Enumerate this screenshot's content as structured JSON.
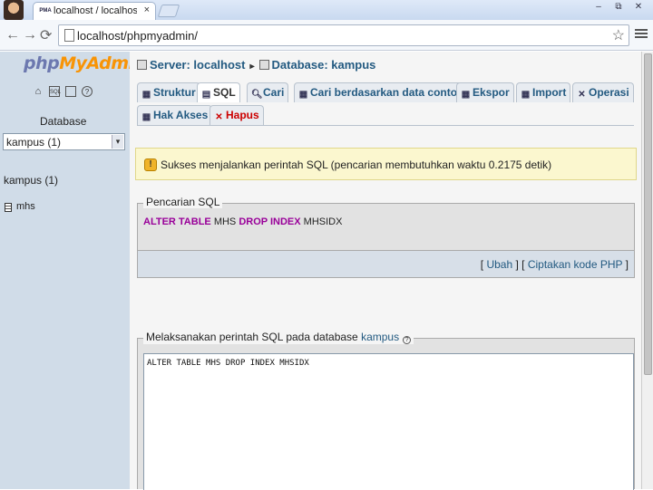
{
  "browser": {
    "tab_favicon": "PMA",
    "tab_title": "localhost / localhost / kampus",
    "tab_close": "×",
    "url": "localhost/phpmyadmin/",
    "window_controls": [
      "–",
      "⧉",
      "✕"
    ]
  },
  "sidebar": {
    "logo_php": "php",
    "logo_myadmin": "MyAdmin",
    "icons": [
      "home-icon",
      "sql-icon",
      "query-window-icon",
      "docs-icon"
    ],
    "database_label": "Database",
    "database_select_value": "kampus (1)",
    "database_name": "kampus (1)",
    "tables": [
      "mhs"
    ]
  },
  "breadcrumb": {
    "server": "Server: localhost",
    "separator": "▸",
    "database": "Database: kampus"
  },
  "tabs": [
    {
      "label": "Struktur"
    },
    {
      "label": "SQL"
    },
    {
      "label": "Cari"
    },
    {
      "label": "Cari berdasarkan data contoh"
    },
    {
      "label": "Ekspor"
    },
    {
      "label": "Import"
    },
    {
      "label": "Operasi"
    },
    {
      "label": "Hak Akses"
    },
    {
      "label": "Hapus"
    }
  ],
  "success_message": "Sukses menjalankan perintah SQL (pencarian membutuhkan waktu 0.2175 detik)",
  "sql_query": {
    "legend": "Pencarian SQL",
    "keyword1": "ALTER TABLE",
    "table": "MHS",
    "keyword2": "DROP INDEX",
    "index": "MHSIDX",
    "edit_link": "Ubah",
    "php_link": "Ciptakan kode PHP"
  },
  "run_sql": {
    "legend_prefix": "Melaksanakan perintah SQL pada database",
    "database_link": "kampus",
    "textarea_value": "ALTER TABLE MHS DROP INDEX MHSIDX"
  },
  "colors": {
    "link": "#235a81",
    "sql_keyword": "#990099",
    "delete": "#cc0000",
    "success_bg": "#fbf7cf",
    "sidebar_bg": "#d0dce8"
  }
}
